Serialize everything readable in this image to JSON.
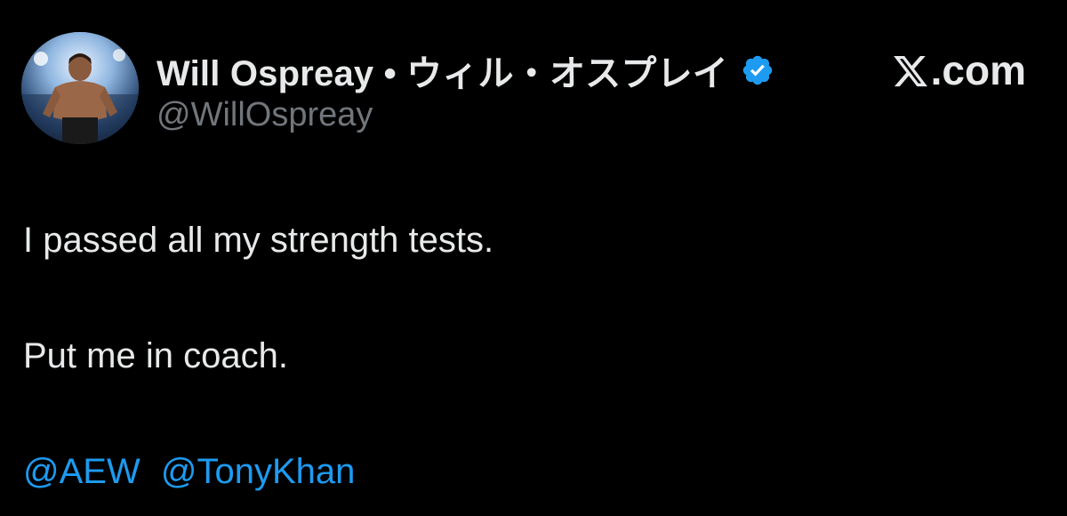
{
  "author": {
    "display_name": "Will Ospreay • ウィル・オスプレイ",
    "handle": "@WillOspreay",
    "verified": true
  },
  "brand": {
    "label": ".com",
    "icon": "x-logo-icon"
  },
  "tweet": {
    "lines": [
      "I passed all my strength tests.",
      "Put me in coach."
    ],
    "mentions": [
      "@AEW",
      "@TonyKhan"
    ]
  },
  "colors": {
    "background": "#000000",
    "text": "#e7e9ea",
    "handle": "#71767b",
    "link": "#1d9bf0",
    "verified_badge": "#1d9bf0"
  }
}
